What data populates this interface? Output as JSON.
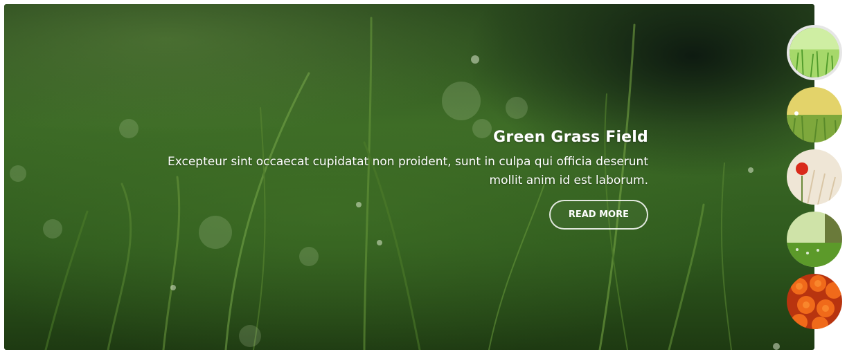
{
  "slide": {
    "title": "Green Grass Field",
    "text": "Excepteur sint occaecat cupidatat non proident, sunt in culpa qui officia deserunt mollit anim id est laborum.",
    "button_label": "READ MORE"
  },
  "thumbnails": [
    {
      "name": "green-grass-dew",
      "active": true
    },
    {
      "name": "yellow-meadow",
      "active": false
    },
    {
      "name": "red-poppy",
      "active": false
    },
    {
      "name": "sunny-field",
      "active": false
    },
    {
      "name": "orange-roses",
      "active": false
    }
  ],
  "colors": {
    "accent": "#ffffff",
    "background_green": "#3c6a26",
    "active_thumb_border": "#e6e6e6"
  }
}
